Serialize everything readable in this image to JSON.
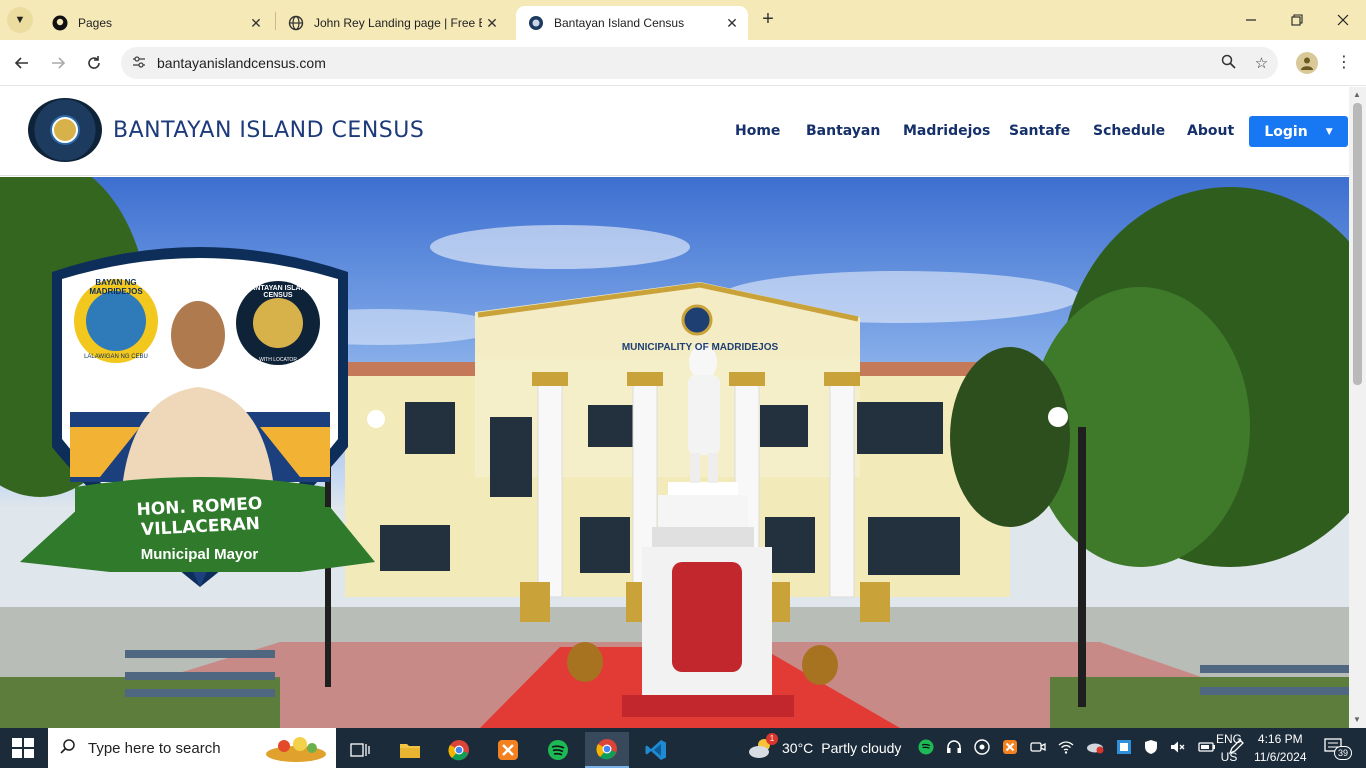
{
  "browser": {
    "tabs": [
      {
        "title": "Pages",
        "icon": "github-icon",
        "active": false
      },
      {
        "title": "John Rey Landing page | Free B",
        "icon": "globe-icon",
        "active": false
      },
      {
        "title": "Bantayan Island Census",
        "icon": "site-icon",
        "active": true
      }
    ],
    "url": "bantayanislandcensus.com"
  },
  "site": {
    "brand": "BANTAYAN ISLAND CENSUS",
    "nav": [
      "Home",
      "Bantayan",
      "Madridejos",
      "Santafe",
      "Schedule",
      "About"
    ],
    "login_label": "Login"
  },
  "hero": {
    "seal_left_text": "BAYAN NG MADRIDEJOS",
    "seal_left_sub": "LALAWIGAN NG CEBU",
    "seal_right_text": "BANTAYAN ISLAND CENSUS",
    "seal_right_sub": "WITH LOCATOR",
    "mayor_name": "HON. ROMEO VILLACERAN",
    "mayor_title": "Municipal Mayor",
    "building_sign": "MUNICIPALITY OF MADRIDEJOS"
  },
  "taskbar": {
    "search_placeholder": "Type here to search",
    "weather_temp": "30°C",
    "weather_desc": "Partly cloudy",
    "weather_badge": "1",
    "lang_top": "ENG",
    "lang_bottom": "US",
    "time": "4:16 PM",
    "date": "11/6/2024",
    "notifications": "39"
  },
  "colors": {
    "tabstrip": "#f6e9b8",
    "brand_text": "#1d3a7a",
    "login_bg": "#1877f2",
    "taskbar": "#1c2b3a"
  }
}
